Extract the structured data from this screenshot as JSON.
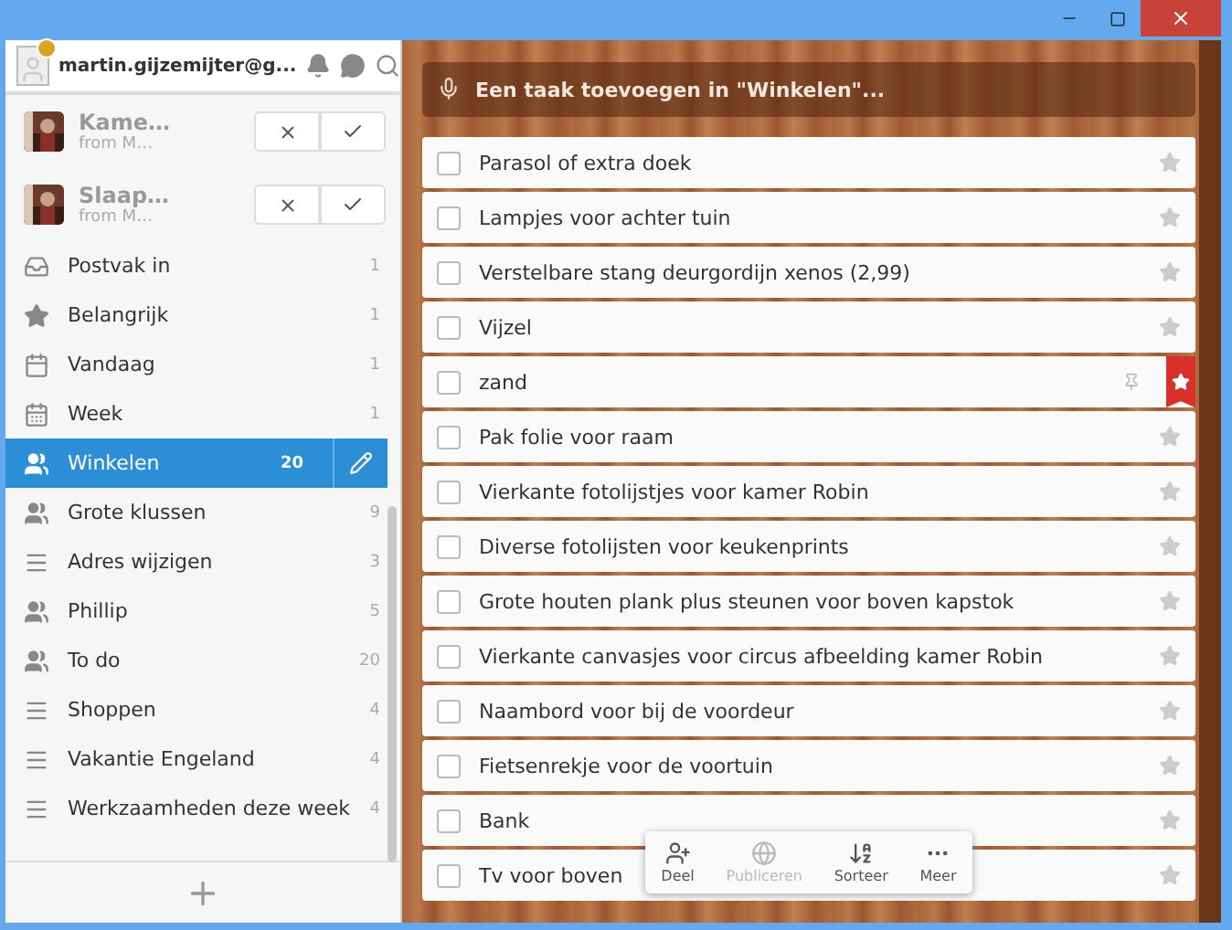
{
  "account": {
    "email": "martin.gijzemijter@g..."
  },
  "share_requests": [
    {
      "title": "Kame…",
      "subtitle": "from M…"
    },
    {
      "title": "Slaap…",
      "subtitle": "from M…"
    }
  ],
  "lists": [
    {
      "kind": "inbox",
      "name": "Postvak in",
      "count": "1",
      "selected": false
    },
    {
      "kind": "starred",
      "name": "Belangrijk",
      "count": "1",
      "selected": false
    },
    {
      "kind": "today",
      "name": "Vandaag",
      "count": "1",
      "selected": false
    },
    {
      "kind": "week",
      "name": "Week",
      "count": "1",
      "selected": false
    },
    {
      "kind": "shared",
      "name": "Winkelen",
      "count": "20",
      "selected": true
    },
    {
      "kind": "shared",
      "name": "Grote klussen",
      "count": "9",
      "selected": false
    },
    {
      "kind": "list",
      "name": "Adres wijzigen",
      "count": "3",
      "selected": false
    },
    {
      "kind": "shared",
      "name": "Phillip",
      "count": "5",
      "selected": false
    },
    {
      "kind": "shared",
      "name": "To do",
      "count": "20",
      "selected": false
    },
    {
      "kind": "list",
      "name": "Shoppen",
      "count": "4",
      "selected": false
    },
    {
      "kind": "list",
      "name": "Vakantie Engeland",
      "count": "4",
      "selected": false
    },
    {
      "kind": "list",
      "name": "Werkzaamheden deze week",
      "count": "4",
      "selected": false
    }
  ],
  "add_task": {
    "placeholder": "Een taak toevoegen in \"Winkelen\"..."
  },
  "tasks": [
    {
      "title": "Parasol of extra doek",
      "checked": false,
      "starred": false,
      "pinned": false
    },
    {
      "title": "Lampjes voor achter tuin",
      "checked": false,
      "starred": false,
      "pinned": false
    },
    {
      "title": "Verstelbare stang deurgordijn xenos (2,99)",
      "checked": false,
      "starred": false,
      "pinned": false
    },
    {
      "title": "Vijzel",
      "checked": false,
      "starred": false,
      "pinned": false
    },
    {
      "title": "zand",
      "checked": false,
      "starred": true,
      "pinned": true
    },
    {
      "title": "Pak folie voor raam",
      "checked": false,
      "starred": false,
      "pinned": false
    },
    {
      "title": "Vierkante fotolijstjes voor kamer Robin",
      "checked": false,
      "starred": false,
      "pinned": false
    },
    {
      "title": "Diverse fotolijsten voor keukenprints",
      "checked": false,
      "starred": false,
      "pinned": false
    },
    {
      "title": "Grote houten plank plus steunen voor boven kapstok",
      "checked": false,
      "starred": false,
      "pinned": false
    },
    {
      "title": "Vierkante canvasjes voor circus afbeelding kamer Robin",
      "checked": false,
      "starred": false,
      "pinned": false
    },
    {
      "title": "Naambord voor bij de voordeur",
      "checked": false,
      "starred": false,
      "pinned": false
    },
    {
      "title": "Fietsenrekje voor de voortuin",
      "checked": false,
      "starred": false,
      "pinned": false
    },
    {
      "title": "Bank",
      "checked": false,
      "starred": false,
      "pinned": false
    },
    {
      "title": "Tv voor boven",
      "checked": false,
      "starred": false,
      "pinned": false
    }
  ],
  "toolbar": [
    {
      "kind": "share",
      "label": "Deel",
      "disabled": false
    },
    {
      "kind": "publish",
      "label": "Publiceren",
      "disabled": true
    },
    {
      "kind": "sort",
      "label": "Sorteer",
      "disabled": false
    },
    {
      "kind": "more",
      "label": "Meer",
      "disabled": false
    }
  ]
}
